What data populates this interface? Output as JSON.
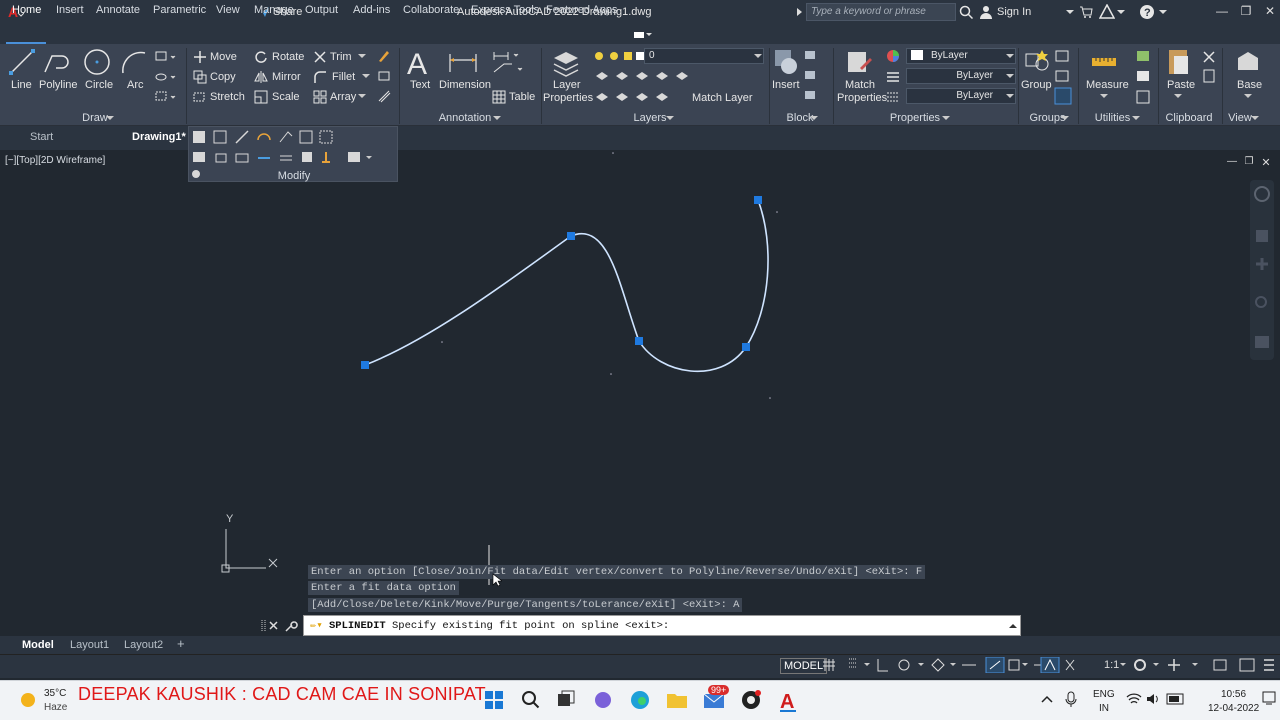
{
  "title": "Autodesk AutoCAD 2022   Drawing1.dwg",
  "share_label": "Share",
  "search_placeholder": "Type a keyword or phrase",
  "sign_in": "Sign In",
  "ribbon_tabs": [
    "Home",
    "Insert",
    "Annotate",
    "Parametric",
    "View",
    "Manage",
    "Output",
    "Add-ins",
    "Collaborate",
    "Express Tools",
    "Featured Apps"
  ],
  "draw": {
    "title": "Draw",
    "line": "Line",
    "polyline": "Polyline",
    "circle": "Circle",
    "arc": "Arc"
  },
  "modify": {
    "title": "Modify",
    "move": "Move",
    "rotate": "Rotate",
    "trim": "Trim",
    "copy": "Copy",
    "mirror": "Mirror",
    "fillet": "Fillet",
    "stretch": "Stretch",
    "scale": "Scale",
    "array": "Array"
  },
  "annotation": {
    "title": "Annotation",
    "text": "Text",
    "dimension": "Dimension",
    "table": "Table"
  },
  "layers": {
    "title": "Layers",
    "layer_properties_1": "Layer",
    "layer_properties_2": "Properties",
    "current_layer": "0",
    "match_layer": "Match Layer"
  },
  "block": {
    "title": "Block",
    "insert": "Insert"
  },
  "properties": {
    "title": "Properties",
    "match_1": "Match",
    "match_2": "Properties",
    "color": "ByLayer",
    "linetype": "ByLayer",
    "lineweight": "ByLayer"
  },
  "groups": {
    "title": "Groups",
    "group": "Group"
  },
  "utilities": {
    "title": "Utilities",
    "measure": "Measure"
  },
  "clipboard": {
    "title": "Clipboard",
    "paste": "Paste"
  },
  "view_panel": {
    "title": "View",
    "base": "Base"
  },
  "doc_tabs": {
    "start": "Start",
    "drawing": "Drawing1*"
  },
  "viewport_label": "[−][Top][2D Wireframe]",
  "ucs": {
    "y": "Y",
    "x": "X"
  },
  "command_history": [
    "Enter an option [Close/Join/Fit data/Edit vertex/convert to Polyline/Reverse/Undo/eXit] <eXit>: F",
    "Enter a fit data option",
    "[Add/Close/Delete/Kink/Move/Purge/Tangents/toLerance/eXit] <eXit>: A"
  ],
  "command_prompt": {
    "command": "SPLINEDIT",
    "text": " Specify existing fit point on spline <exit>:"
  },
  "layout_tabs": [
    "Model",
    "Layout1",
    "Layout2"
  ],
  "status": {
    "model": "MODEL",
    "scale": "1:1"
  },
  "taskbar": {
    "temp": "35°C",
    "weather": "Haze",
    "banner": "DEEPAK KAUSHIK : CAD CAM CAE IN SONIPAT",
    "mail_badge": "99+",
    "lang_1": "ENG",
    "lang_2": "IN",
    "time": "10:56",
    "date": "12-04-2022"
  },
  "colors": {
    "accent": "#4a90d9",
    "canvas": "#212830",
    "ribbon": "#3b4453",
    "spline": "#cfe4ff",
    "grip": "#1f7ae0",
    "banner": "#e01818"
  }
}
